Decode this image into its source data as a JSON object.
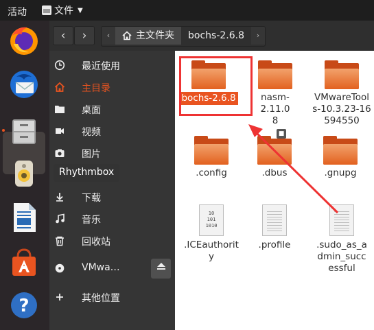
{
  "topbar": {
    "activities": "活动",
    "app_menu": {
      "label": "文件",
      "icon": "file-manager-icon"
    }
  },
  "dock": {
    "items": [
      {
        "name": "firefox-icon",
        "active": false
      },
      {
        "name": "thunderbird-icon",
        "active": false
      },
      {
        "name": "files-icon",
        "active": true
      },
      {
        "name": "rhythmbox-icon",
        "active": false
      },
      {
        "name": "libreoffice-writer-icon",
        "active": false
      },
      {
        "name": "ubuntu-software-icon",
        "active": false
      },
      {
        "name": "help-icon",
        "active": false
      }
    ],
    "tooltip": "Rhythmbox"
  },
  "header": {
    "back": "‹",
    "forward": "›",
    "breadcrumb": {
      "left_arrow": "‹",
      "home_label": "主文件夹",
      "current_label": "bochs-2.6.8",
      "right_arrow": "›"
    }
  },
  "sidebar": {
    "items": [
      {
        "label": "最近使用",
        "icon": "clock-icon",
        "active": false
      },
      {
        "label": "主目录",
        "icon": "home-icon",
        "active": true
      },
      {
        "label": "桌面",
        "icon": "desktop-folder-icon",
        "active": false
      },
      {
        "label": "视频",
        "icon": "video-icon",
        "active": false
      },
      {
        "label": "图片",
        "icon": "camera-icon",
        "active": false
      },
      {
        "label": "",
        "icon": "document-icon",
        "active": false
      },
      {
        "label": "下载",
        "icon": "download-icon",
        "active": false
      },
      {
        "label": "音乐",
        "icon": "music-icon",
        "active": false
      },
      {
        "label": "回收站",
        "icon": "trash-icon",
        "active": false
      },
      {
        "label": "VMwa…",
        "icon": "disc-icon",
        "active": false
      },
      {
        "label": "其他位置",
        "icon": "plus-icon",
        "active": false
      }
    ],
    "eject_icon": "eject-icon"
  },
  "files": [
    {
      "name": "bochs-2.6.8",
      "type": "folder",
      "selected": true
    },
    {
      "name": "nasm-2.11.08",
      "type": "folder",
      "selected": false
    },
    {
      "name": "VMwareTools-10.3.23-16594550",
      "type": "folder",
      "selected": false
    },
    {
      "name": ".config",
      "type": "folder",
      "selected": false
    },
    {
      "name": ".dbus",
      "type": "folder-locked",
      "selected": false
    },
    {
      "name": ".gnupg",
      "type": "folder",
      "selected": false
    },
    {
      "name": ".ICEauthority",
      "type": "binary-file",
      "selected": false
    },
    {
      "name": ".profile",
      "type": "text-file",
      "selected": false
    },
    {
      "name": ".sudo_as_admin_successful",
      "type": "text-file",
      "selected": false
    }
  ],
  "colors": {
    "accent": "#e95420",
    "annotation": "#e53333",
    "topbar": "#1e1e1e",
    "sidebar": "#353535"
  }
}
